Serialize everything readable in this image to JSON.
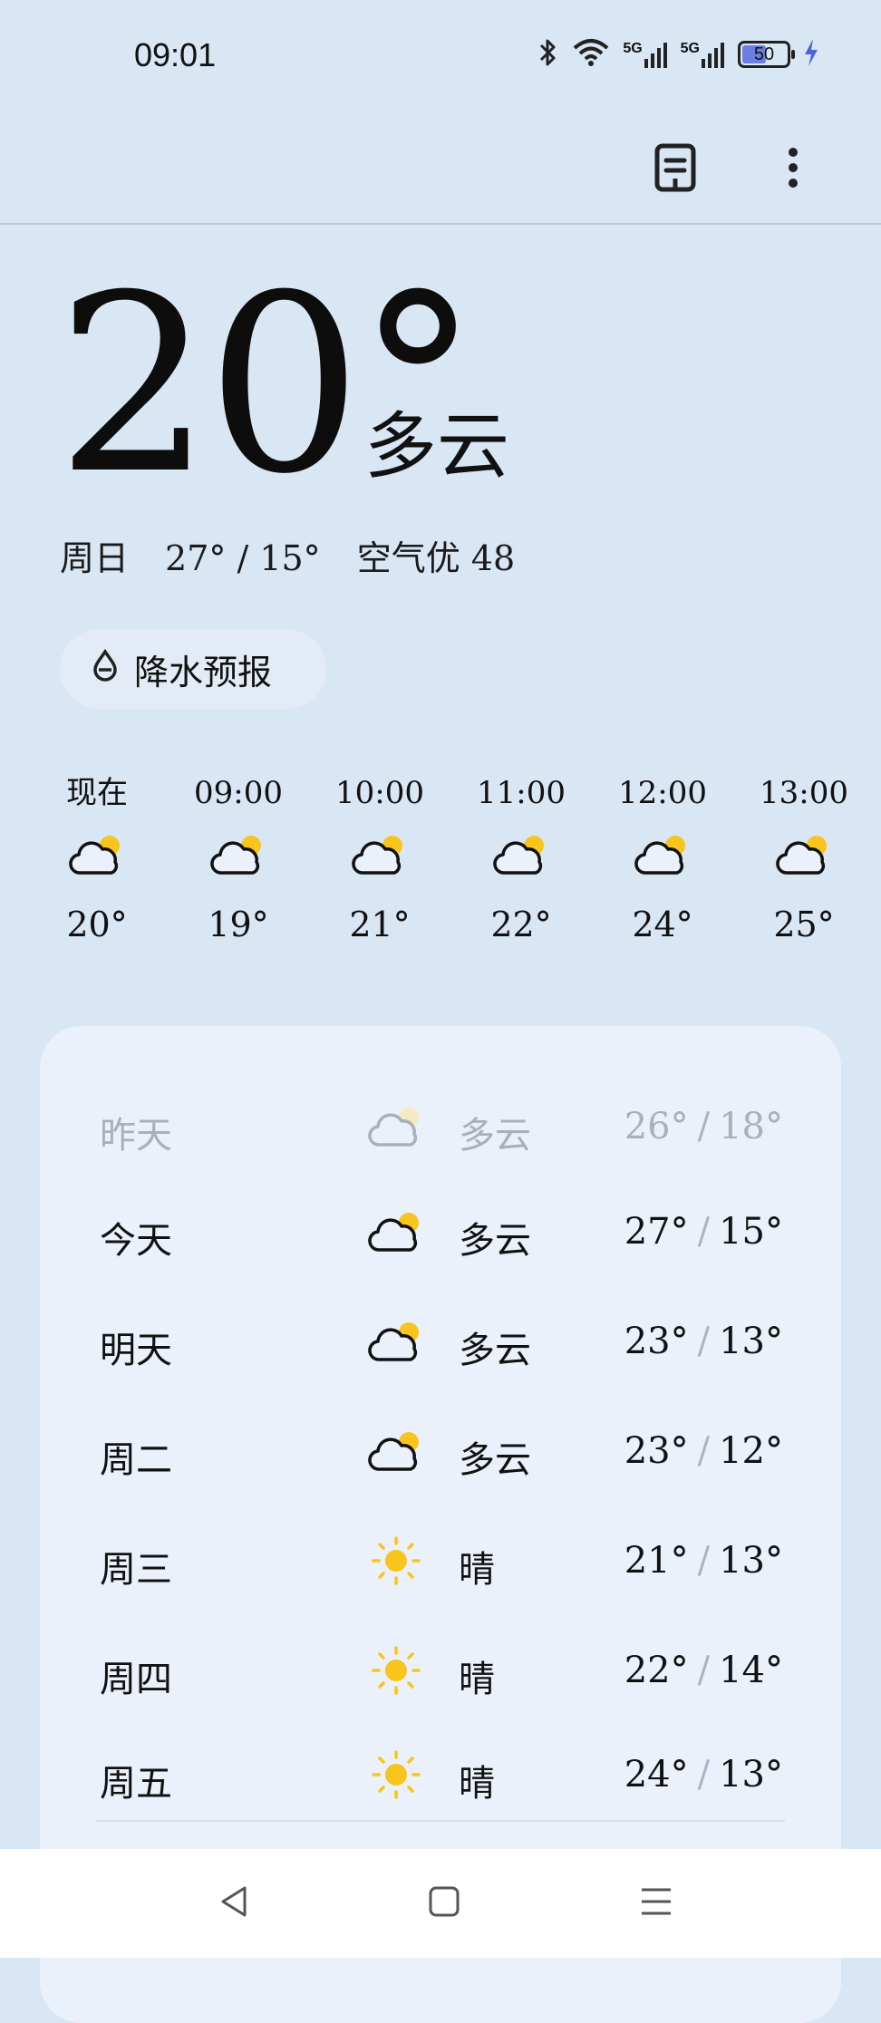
{
  "status_bar": {
    "time": "09:01",
    "network_label_1": "5G",
    "network_label_2": "5G",
    "battery_level": "50"
  },
  "top_bar": {
    "icons": [
      "document-icon",
      "more-vertical-icon"
    ]
  },
  "current": {
    "temperature": "20°",
    "condition": "多云",
    "day": "周日",
    "high_low": "27° / 15°",
    "air_quality": "空气优 48"
  },
  "precipitation_button": {
    "label": "降水预报",
    "icon": "raindrop-icon"
  },
  "hourly": [
    {
      "time": "现在",
      "temp": "20°",
      "icon": "partly-cloudy-icon"
    },
    {
      "time": "09:00",
      "temp": "19°",
      "icon": "partly-cloudy-icon"
    },
    {
      "time": "10:00",
      "temp": "21°",
      "icon": "partly-cloudy-icon"
    },
    {
      "time": "11:00",
      "temp": "22°",
      "icon": "partly-cloudy-icon"
    },
    {
      "time": "12:00",
      "temp": "24°",
      "icon": "partly-cloudy-icon"
    },
    {
      "time": "13:00",
      "temp": "25°",
      "icon": "partly-cloudy-icon"
    }
  ],
  "daily": [
    {
      "day": "昨天",
      "condition": "多云",
      "high": "26°",
      "sep": "/",
      "low": "18°",
      "icon": "partly-cloudy-icon",
      "past": true
    },
    {
      "day": "今天",
      "condition": "多云",
      "high": "27°",
      "sep": "/",
      "low": "15°",
      "icon": "partly-cloudy-icon"
    },
    {
      "day": "明天",
      "condition": "多云",
      "high": "23°",
      "sep": "/",
      "low": "13°",
      "icon": "partly-cloudy-icon"
    },
    {
      "day": "周二",
      "condition": "多云",
      "high": "23°",
      "sep": "/",
      "low": "12°",
      "icon": "partly-cloudy-icon"
    },
    {
      "day": "周三",
      "condition": "晴",
      "high": "21°",
      "sep": "/",
      "low": "13°",
      "icon": "sun-icon"
    },
    {
      "day": "周四",
      "condition": "晴",
      "high": "22°",
      "sep": "/",
      "low": "14°",
      "icon": "sun-icon"
    },
    {
      "day": "周五",
      "condition": "晴",
      "high": "24°",
      "sep": "/",
      "low": "13°",
      "icon": "sun-icon"
    }
  ],
  "colors": {
    "background": "#d9e6f4",
    "card": "#ebf1fa",
    "sun": "#f8c51e",
    "battery_fill": "#6a7fe0",
    "charging_bolt": "#4a63e0"
  }
}
